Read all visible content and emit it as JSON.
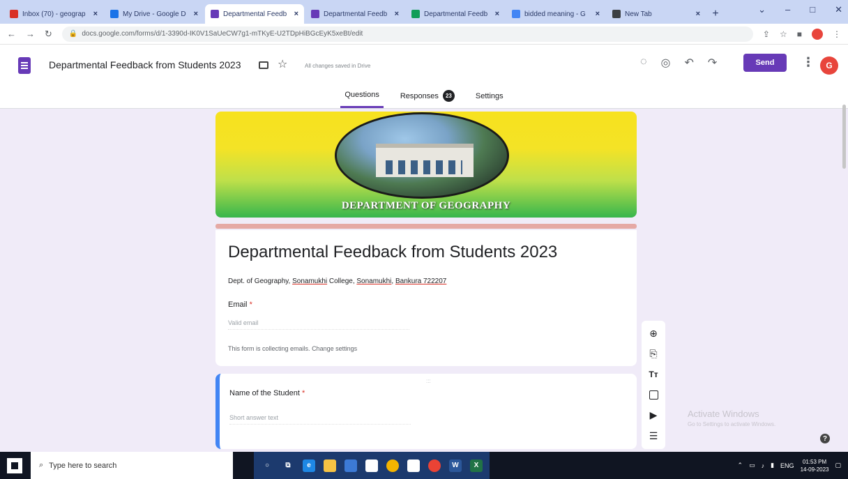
{
  "browser": {
    "tabs": [
      {
        "title": "Inbox (70) - geograp",
        "color": "#d93025",
        "active": false
      },
      {
        "title": "My Drive - Google D",
        "color": "#1a73e8",
        "active": false
      },
      {
        "title": "Departmental Feedb",
        "color": "#673ab7",
        "active": true
      },
      {
        "title": "Departmental Feedb",
        "color": "#673ab7",
        "active": false
      },
      {
        "title": "Departmental Feedb",
        "color": "#0f9d58",
        "active": false
      },
      {
        "title": "bidded meaning - G",
        "color": "#4285f4",
        "active": false
      },
      {
        "title": "New Tab",
        "color": "#3c4043",
        "active": false
      }
    ],
    "new_tab_label": "+",
    "url": "docs.google.com/forms/d/1-3390d-IK0V1SaUeCW7g1-mTKyE-U2TDpHiBGcEyK5xeBt/edit"
  },
  "forms_header": {
    "doc_title": "Departmental Feedback from Students 2023",
    "saved_status": "All changes saved in Drive",
    "send_label": "Send",
    "avatar_letter": "G",
    "tabs": [
      {
        "label": "Questions",
        "active": true
      },
      {
        "label": "Responses",
        "active": false,
        "badge": "23"
      },
      {
        "label": "Settings",
        "active": false
      }
    ]
  },
  "banner": {
    "text": "DEPARTMENT OF GEOGRAPHY"
  },
  "form": {
    "title": "Departmental Feedback from Students 2023",
    "description_parts": [
      "Dept. of Geography, ",
      "Sonamukhi",
      " College, ",
      "Sonamukhi",
      ", ",
      "Bankura 722207"
    ],
    "email_label": "Email",
    "required_marker": "*",
    "email_placeholder": "Valid email",
    "collect_note": "This form is collecting emails.",
    "change_settings": "Change settings"
  },
  "question": {
    "label": "Name of the Student",
    "required_marker": "*",
    "placeholder": "Short answer text",
    "drag_handle": ":::"
  },
  "toolbar": {
    "icons": [
      "add-question-icon",
      "import-questions-icon",
      "add-title-icon",
      "add-image-icon",
      "add-video-icon",
      "add-section-icon"
    ],
    "title_glyph": "Tт"
  },
  "watermark": {
    "title": "Activate Windows",
    "subtitle": "Go to Settings to activate Windows."
  },
  "taskbar": {
    "search_placeholder": "Type here to search",
    "language": "ENG",
    "time": "01:53 PM",
    "date": "14-09-2023"
  },
  "colors": {
    "accent": "#673ab7",
    "background": "#f0ebf8",
    "question_highlight": "#4285f4"
  }
}
